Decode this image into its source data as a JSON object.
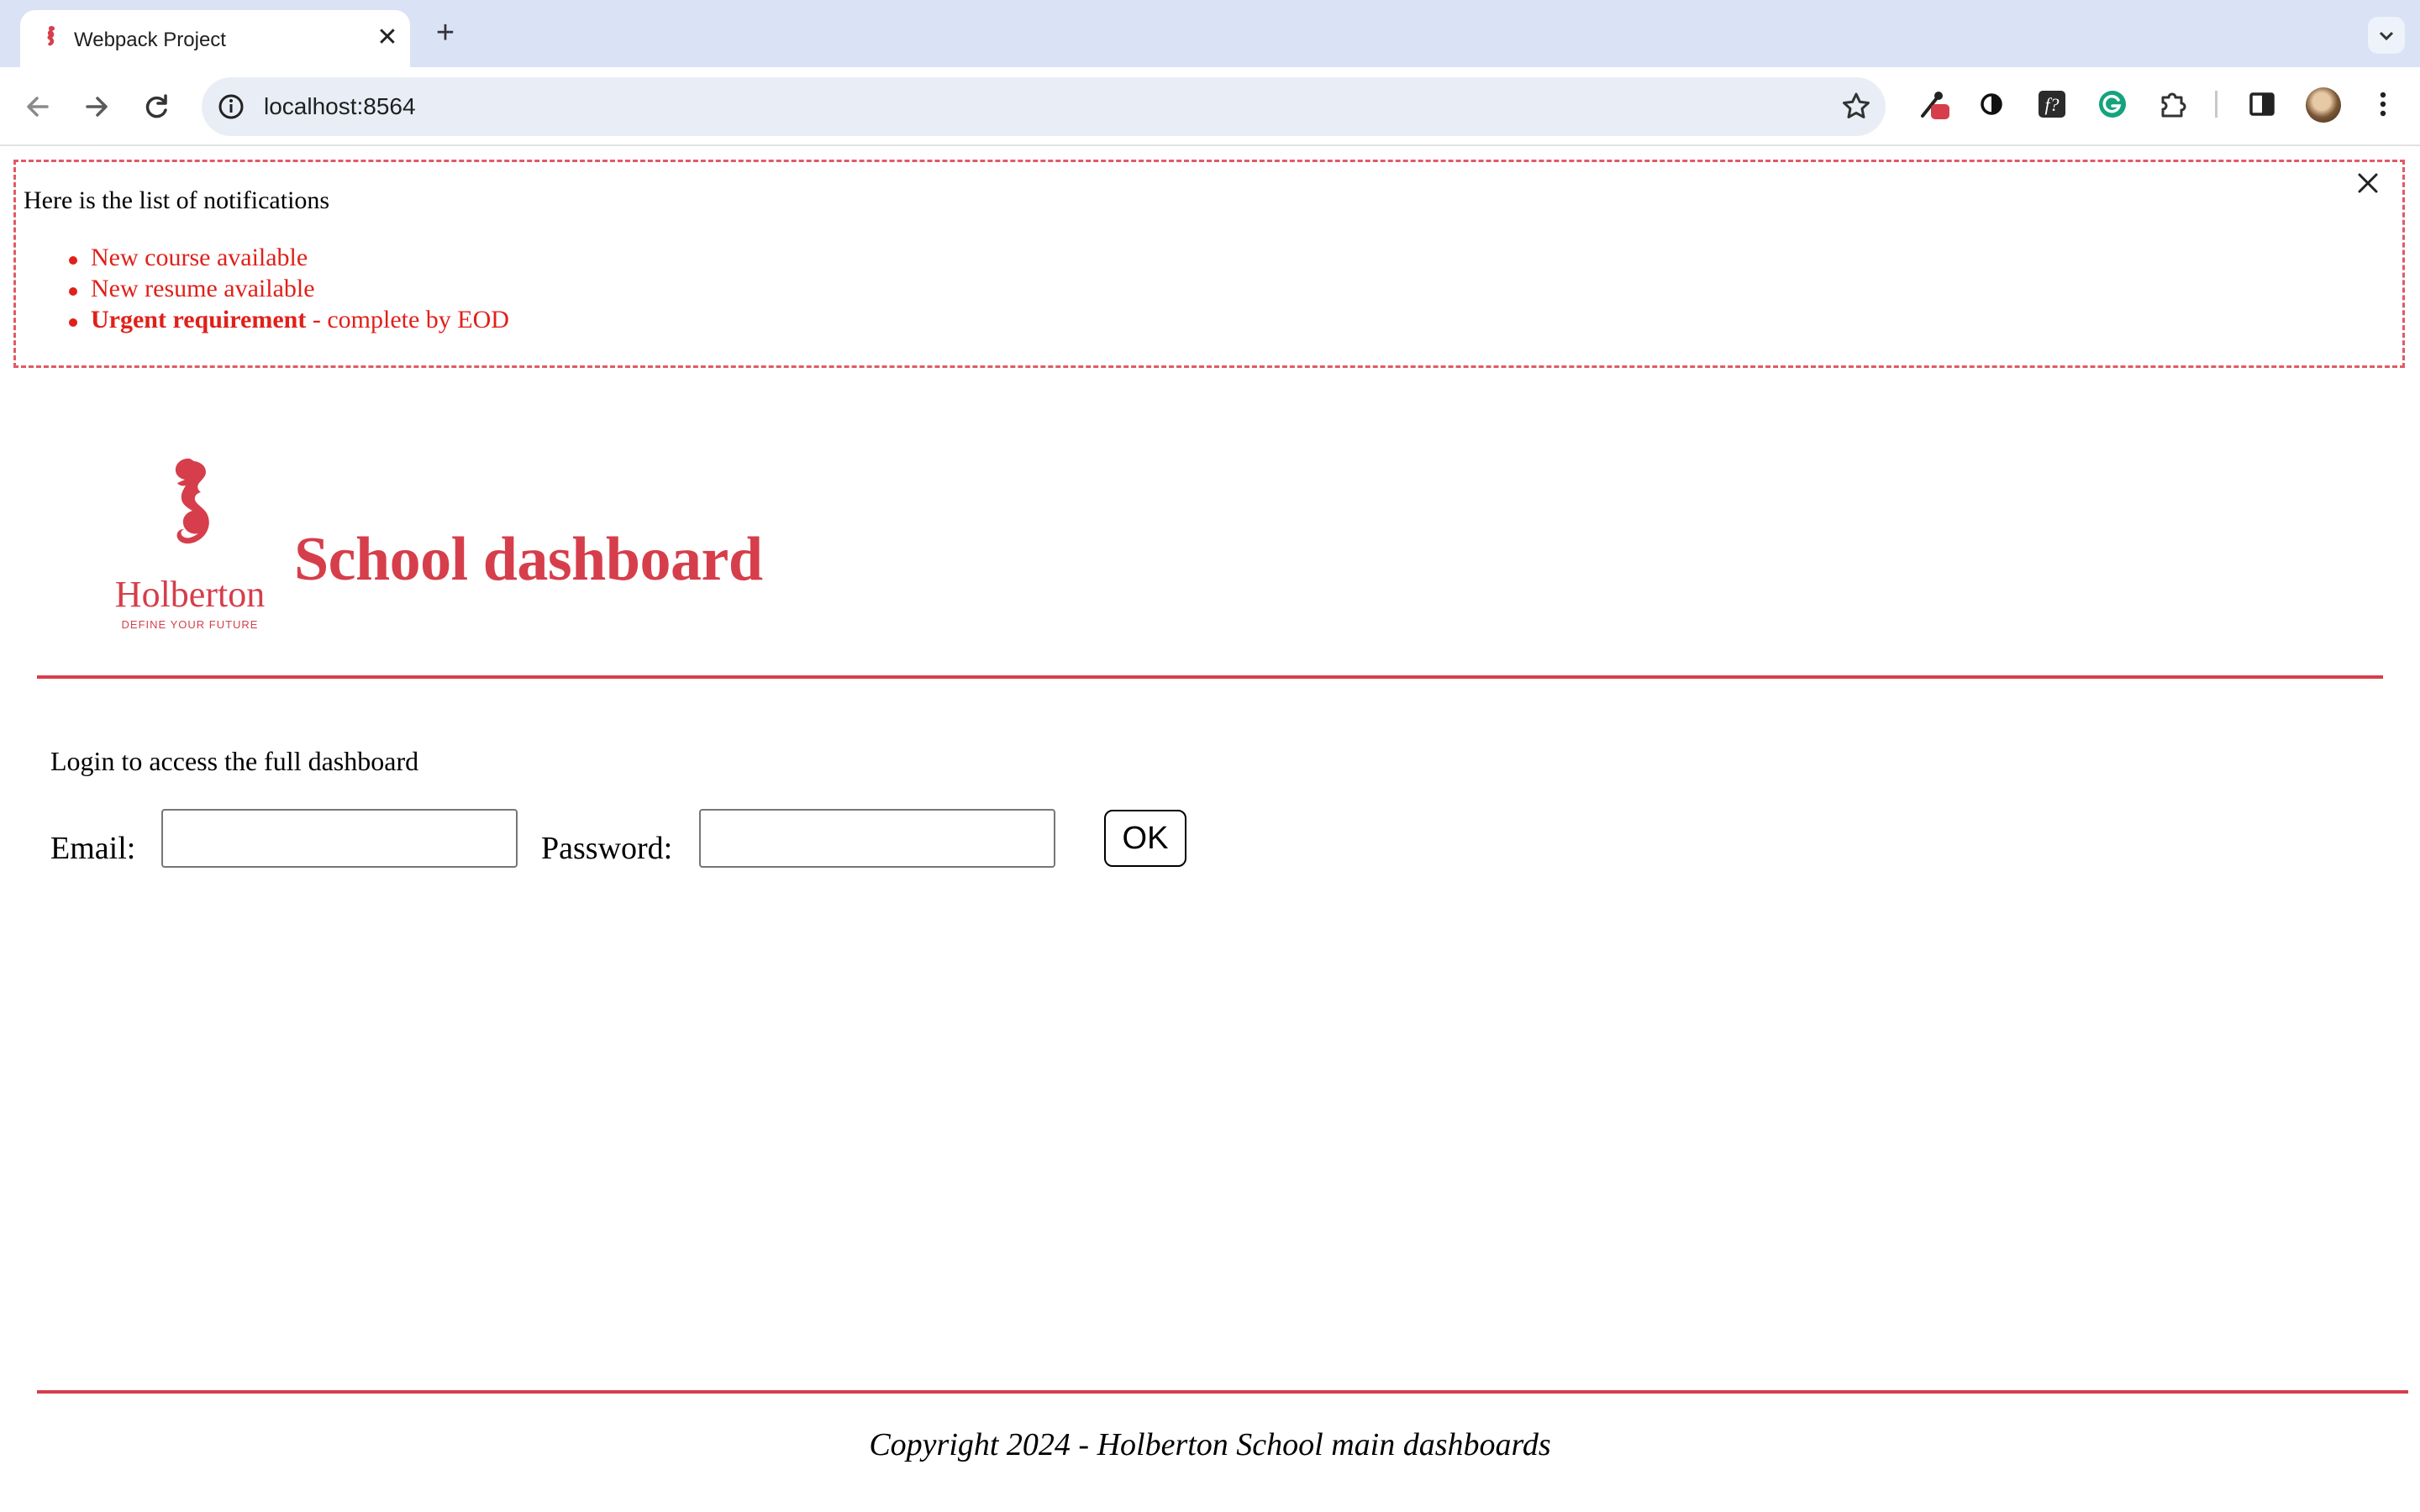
{
  "browser": {
    "tab_title": "Webpack Project",
    "url": "localhost:8564"
  },
  "notifications": {
    "title": "Here is the list of notifications",
    "items": [
      {
        "text": "New course available"
      },
      {
        "text": "New resume available"
      },
      {
        "bold": "Urgent requirement",
        "rest": " - complete by EOD"
      }
    ],
    "color": "#e0201a"
  },
  "header": {
    "title": "School dashboard",
    "logo_name": "Holberton",
    "logo_tagline": "DEFINE YOUR FUTURE",
    "brand_color": "#d63e4b"
  },
  "login": {
    "prompt": "Login to access the full dashboard",
    "email_label": "Email:",
    "password_label": "Password:",
    "submit_label": "OK"
  },
  "footer": {
    "text": "Copyright 2024 - Holberton School main dashboards"
  }
}
